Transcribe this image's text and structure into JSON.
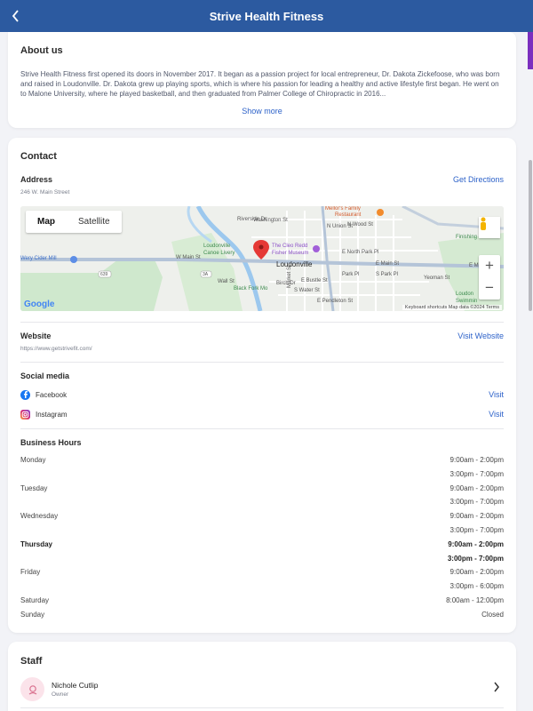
{
  "header": {
    "title": "Strive Health Fitness",
    "back_icon": "chevron-left-icon"
  },
  "about": {
    "heading": "About us",
    "text": "Strive Health Fitness first opened its doors in November 2017. It began as a passion project for local entrepreneur, Dr. Dakota Zickefoose, who was born and raised in Loudonville. Dr. Dakota grew up playing sports, which is where his passion for leading a healthy and active lifestyle first began. He went on to Malone University, where he played basketball, and then graduated from Palmer College of Chiropractic in 2016...",
    "show_more": "Show more"
  },
  "contact": {
    "heading": "Contact",
    "address_label": "Address",
    "address": "246 W. Main Street",
    "directions": "Get Directions",
    "map": {
      "toggle_map": "Map",
      "toggle_satellite": "Satellite",
      "zoom_in": "+",
      "zoom_out": "−",
      "google": "Google",
      "attribution": "Keyboard shortcuts   Map data ©2024   Terms",
      "labels": {
        "mellors": "Mellor's Family",
        "restaurant": "Restaurant",
        "washington": "Washington St",
        "cleo1": "The Cleo Redd",
        "cleo2": "Fisher Museum",
        "canoe1": "Loudonville",
        "canoe2": "Canoe Livery",
        "town": "Loudonville",
        "cider": "Wery Cider Mill",
        "wmain": "W Main St",
        "emain": "E Main St",
        "emain2": "E Main St",
        "northpark": "E North Park Pl",
        "ebustle": "E Bustle St",
        "spark": "S Park Pl",
        "parkpl": "Park Pl",
        "epend": "E Pendleton St",
        "market": "Market St",
        "birch": "Birch Dr",
        "water": "S Water St",
        "wall": "Wall St",
        "riverside": "Riverside Dr",
        "finishing": "Finishing Sw",
        "loudon2": "Loudon",
        "swim": "Swimmin",
        "nunion": "N Union St",
        "nwood": "N Wood St",
        "blackfork": "Black Fork Mo",
        "yeoman": "Yeoman St",
        "r639": "639",
        "r3a": "3A"
      }
    },
    "website_label": "Website",
    "website": "https://www.getstrivefit.com/",
    "visit_website": "Visit Website",
    "social_label": "Social media",
    "social": [
      {
        "name": "Facebook",
        "icon": "facebook-icon",
        "action": "Visit",
        "color": "#1877f2"
      },
      {
        "name": "Instagram",
        "icon": "instagram-icon",
        "action": "Visit",
        "color": "#d62976"
      }
    ],
    "hours_label": "Business Hours",
    "hours": [
      {
        "day": "Monday",
        "time": "9:00am - 2:00pm"
      },
      {
        "day": "",
        "time": "3:00pm - 7:00pm"
      },
      {
        "day": "Tuesday",
        "time": "9:00am - 2:00pm"
      },
      {
        "day": "",
        "time": "3:00pm - 7:00pm"
      },
      {
        "day": "Wednesday",
        "time": "9:00am - 2:00pm"
      },
      {
        "day": "",
        "time": "3:00pm - 7:00pm"
      },
      {
        "day": "Thursday",
        "time": "9:00am - 2:00pm"
      },
      {
        "day": "",
        "time": "3:00pm - 7:00pm"
      },
      {
        "day": "Friday",
        "time": "9:00am - 2:00pm"
      },
      {
        "day": "",
        "time": "3:00pm - 6:00pm"
      },
      {
        "day": "Saturday",
        "time": "8:00am - 12:00pm"
      },
      {
        "day": "Sunday",
        "time": "Closed"
      }
    ]
  },
  "staff": {
    "heading": "Staff",
    "members": [
      {
        "name": "Nichole Cutlip",
        "role": "Owner",
        "icon": "person-icon"
      }
    ]
  },
  "colors": {
    "header": "#2c5aa0",
    "link": "#2d62c9",
    "background": "#f2f3f7"
  }
}
